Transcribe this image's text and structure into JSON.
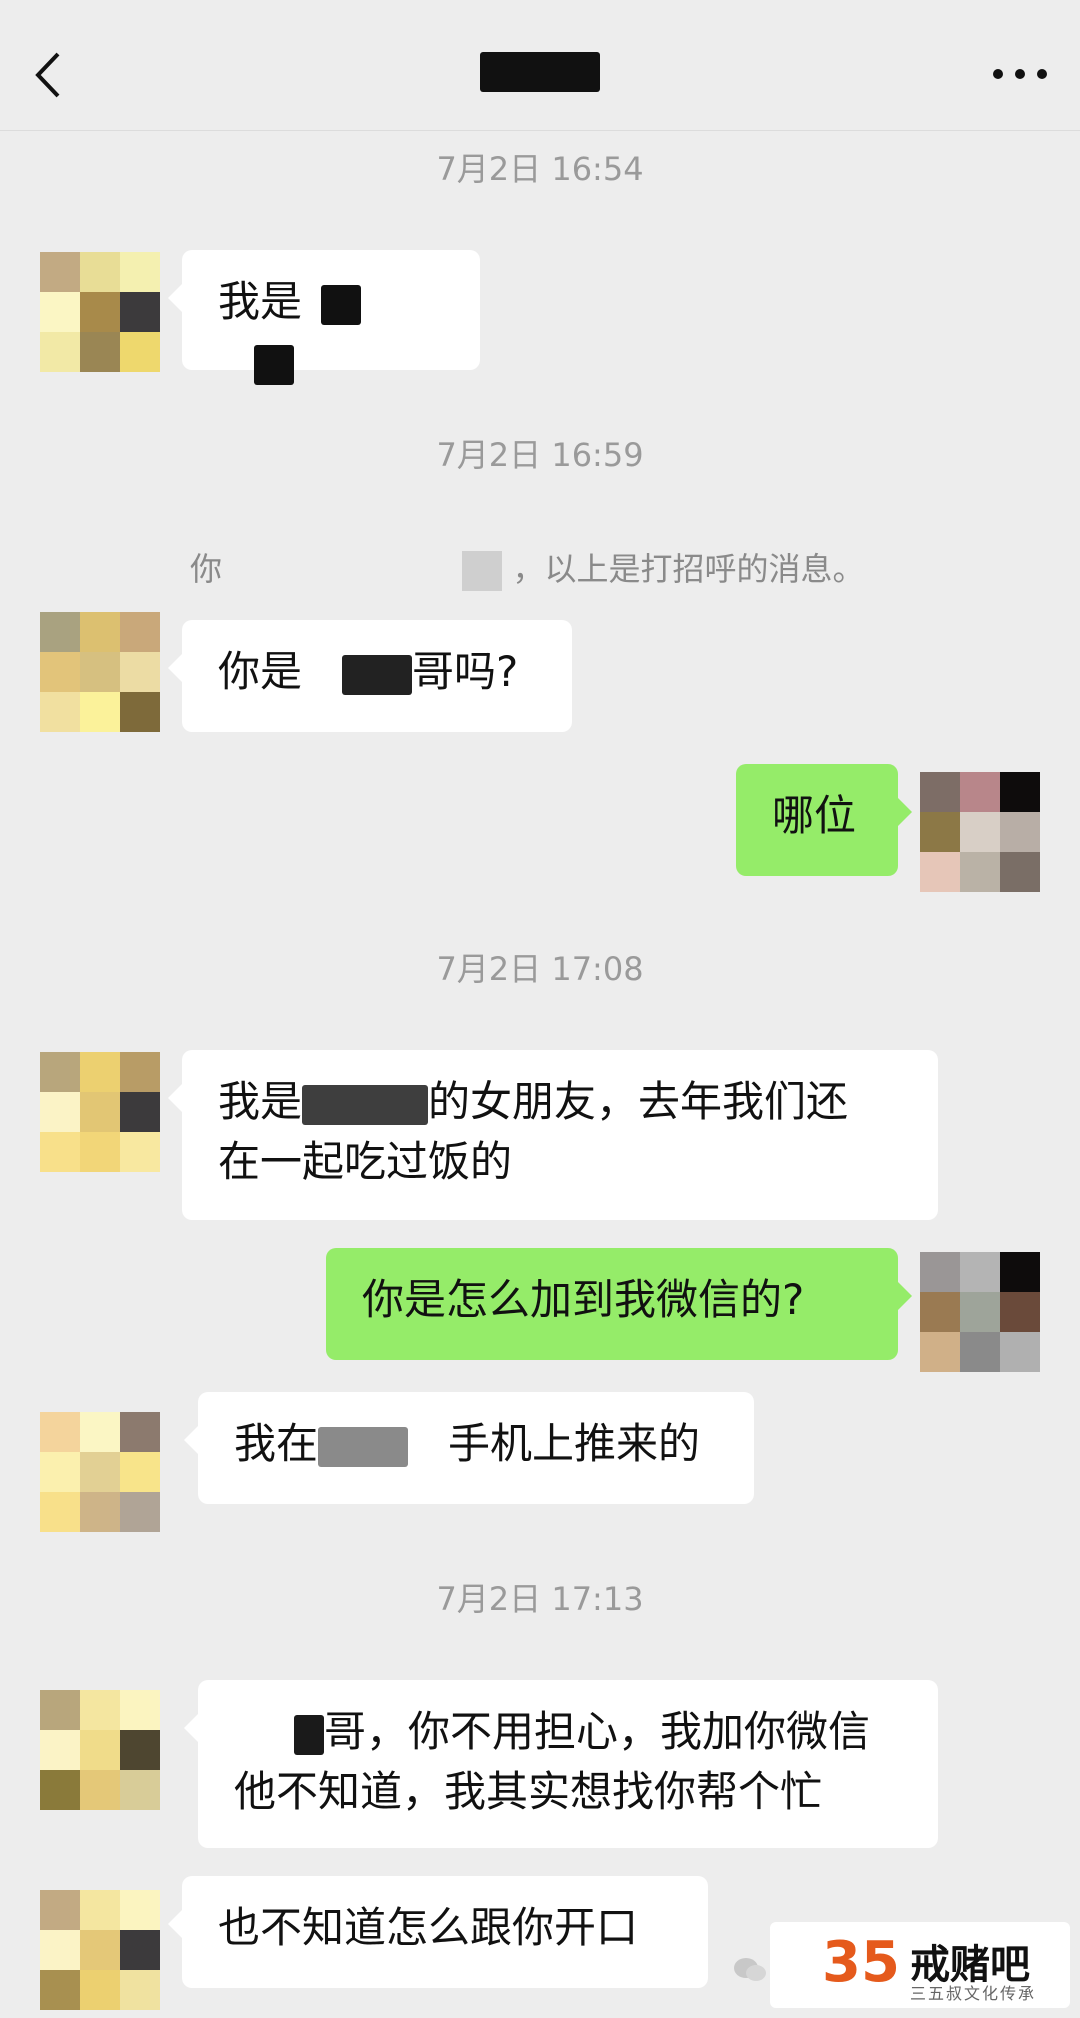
{
  "header": {
    "back_icon": "chevron-left-icon",
    "more_icon": "more-dots-icon"
  },
  "timestamps": [
    "7月2日 16:54",
    "7月2日 16:59",
    "7月2日 17:08",
    "7月2日 17:13"
  ],
  "system_note": {
    "prefix": "你",
    "suffix": "，以上是打招呼的消息。"
  },
  "messages": [
    {
      "side": "left",
      "text_a": "我是",
      "text_b": ""
    },
    {
      "side": "left",
      "text_a": "你是",
      "text_b": "哥吗?"
    },
    {
      "side": "right",
      "text_a": "哪位"
    },
    {
      "side": "left",
      "text_a": "我是",
      "text_b": "的女朋友，去年我们还",
      "text_c": "在一起吃过饭的"
    },
    {
      "side": "right",
      "text_a": "你是怎么加到我微信的?"
    },
    {
      "side": "left",
      "text_a": "我在",
      "text_b": "手机上推来的"
    },
    {
      "side": "left",
      "text_a": "哥，你不用担心，我加你微信",
      "text_b": "他不知道，我其实想找你帮个忙"
    },
    {
      "side": "left",
      "text_a": "也不知道怎么跟你开口"
    }
  ],
  "watermark": {
    "number": "35",
    "title": "戒赌吧",
    "subtitle": "三五叔文化传承"
  }
}
